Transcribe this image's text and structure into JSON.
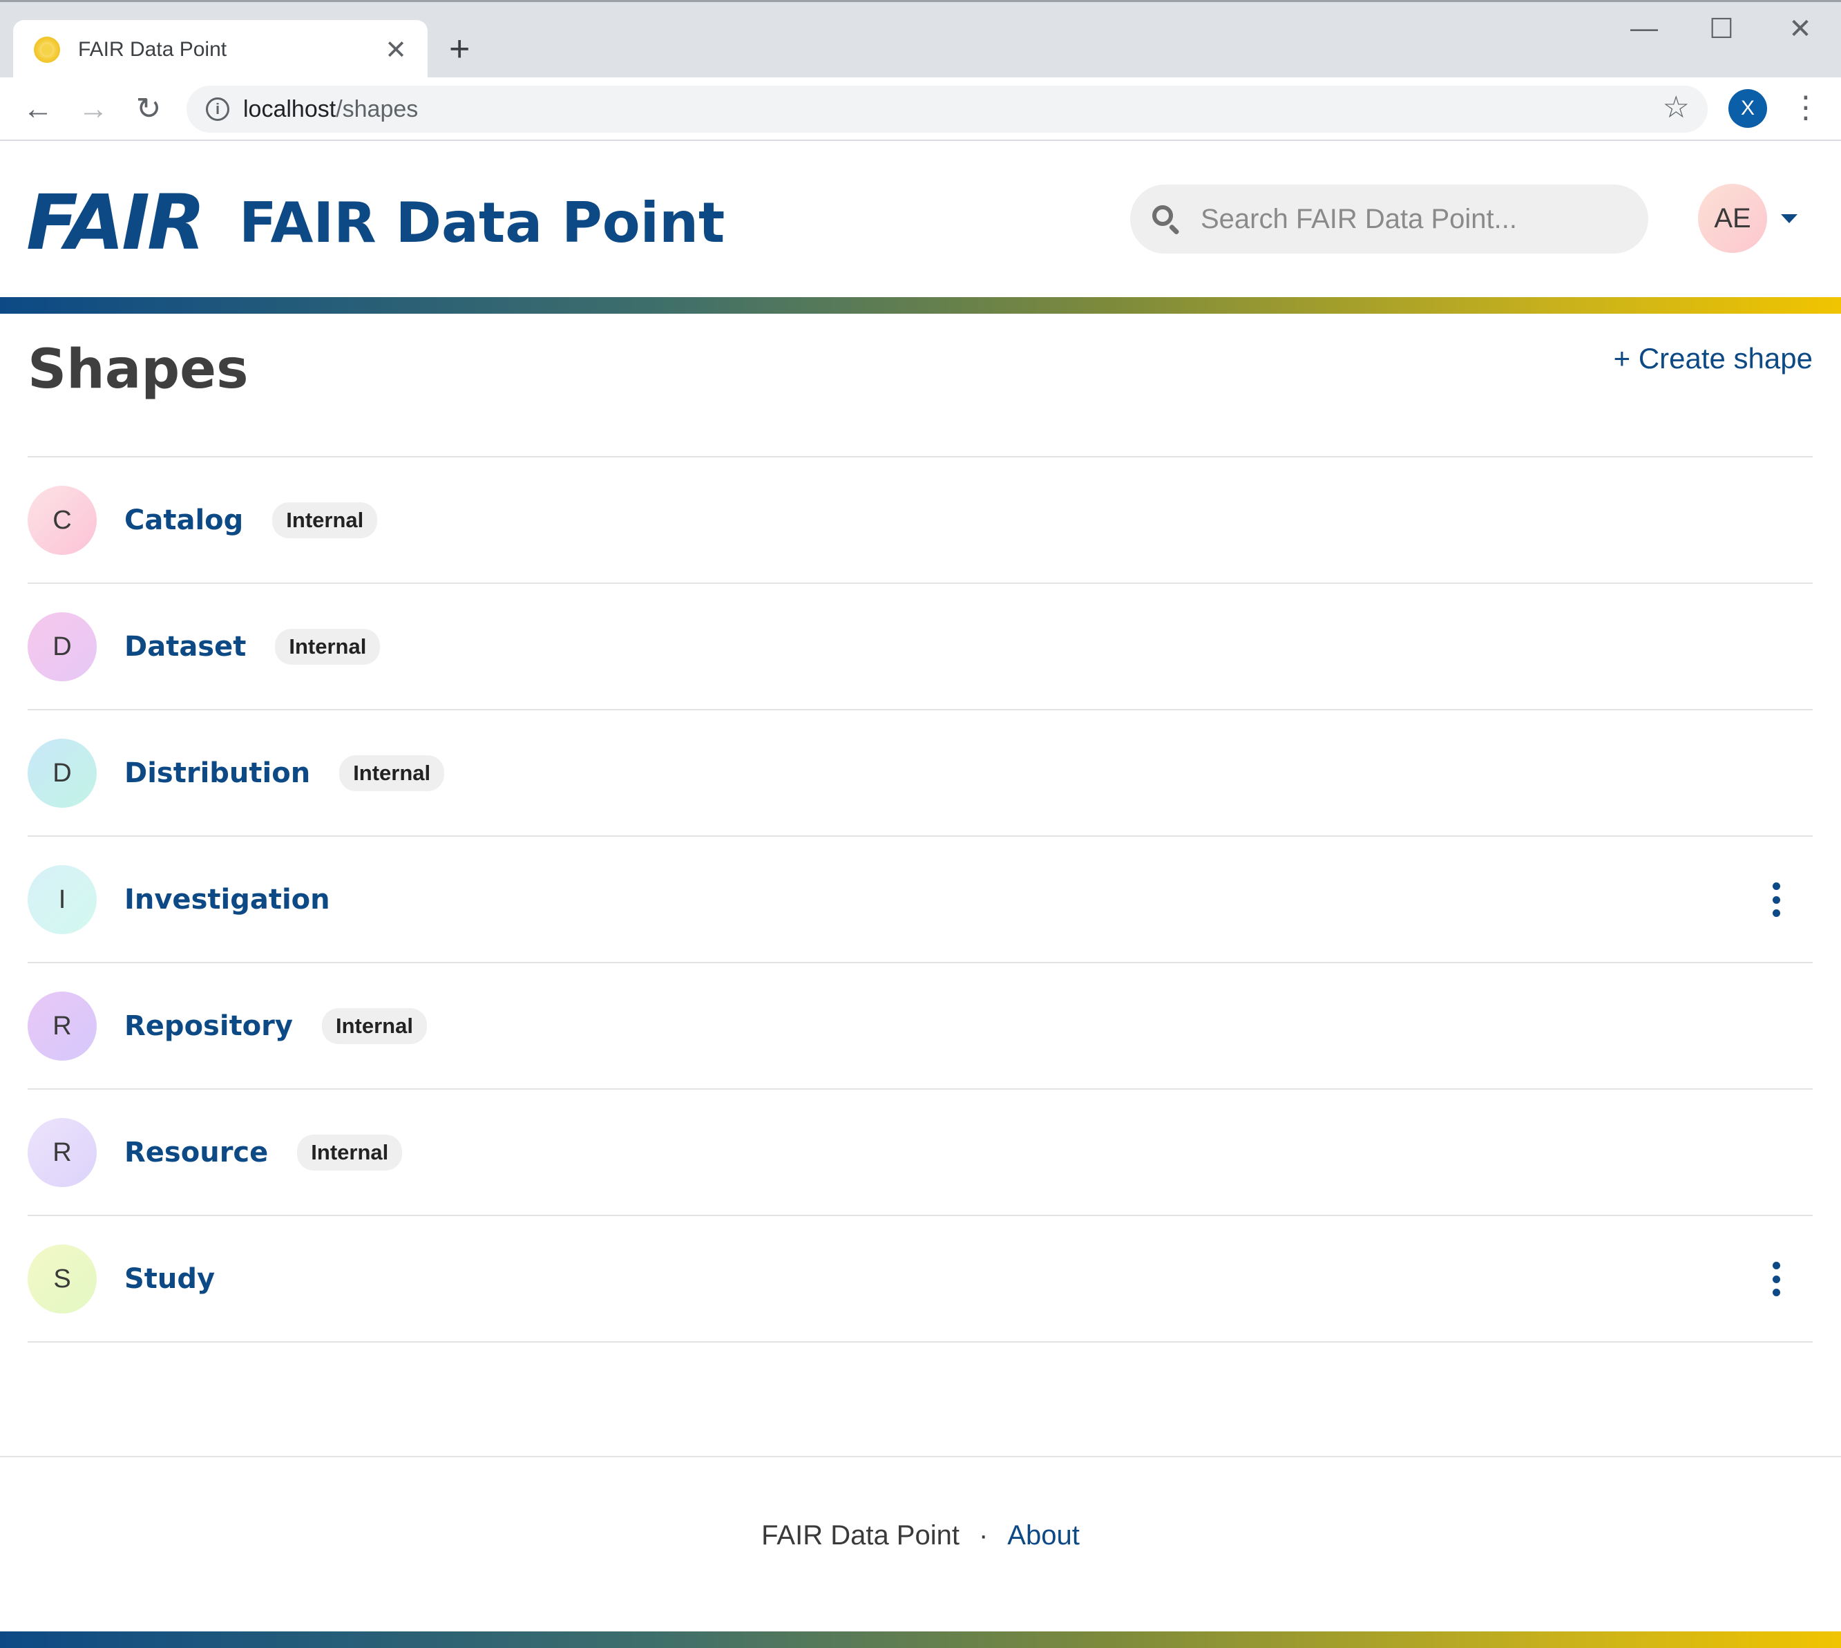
{
  "browser": {
    "tab_title": "FAIR Data Point",
    "tab_close": "✕",
    "new_tab": "+",
    "url_host": "localhost",
    "url_path": "/shapes",
    "profile_initial": "X",
    "window_controls": {
      "minimize": "—",
      "maximize": "☐",
      "close": "✕"
    },
    "nav": {
      "back": "←",
      "forward": "→",
      "reload": "↻"
    },
    "icons": {
      "favicon": "globe-icon",
      "info": "info-icon",
      "star": "star-icon",
      "menu": "kebab-icon"
    }
  },
  "header": {
    "logo_text": "FAIR",
    "app_title": "FAIR Data Point",
    "search_placeholder": "Search FAIR Data Point...",
    "user_initials": "AE"
  },
  "page": {
    "title": "Shapes",
    "create_label": "+ Create shape"
  },
  "shapes": [
    {
      "initial": "C",
      "name": "Catalog",
      "badge": "Internal",
      "color_from": "#fde2e6",
      "color_to": "#fbc3d6",
      "menu": false
    },
    {
      "initial": "D",
      "name": "Dataset",
      "badge": "Internal",
      "color_from": "#f6c8ec",
      "color_to": "#e6c8f6",
      "menu": false
    },
    {
      "initial": "D",
      "name": "Distribution",
      "badge": "Internal",
      "color_from": "#c8e8f8",
      "color_to": "#c3f3e6",
      "menu": false
    },
    {
      "initial": "I",
      "name": "Investigation",
      "badge": "",
      "color_from": "#d8f1f8",
      "color_to": "#d3f8ef",
      "menu": true
    },
    {
      "initial": "R",
      "name": "Repository",
      "badge": "Internal",
      "color_from": "#e8c8f6",
      "color_to": "#d6c8fb",
      "menu": false
    },
    {
      "initial": "R",
      "name": "Resource",
      "badge": "Internal",
      "color_from": "#ece3fb",
      "color_to": "#dcd3fb",
      "menu": false
    },
    {
      "initial": "S",
      "name": "Study",
      "badge": "",
      "color_from": "#f3f8c8",
      "color_to": "#e3f8c3",
      "menu": true
    }
  ],
  "footer": {
    "name": "FAIR Data Point",
    "separator": "·",
    "about": "About"
  },
  "colors": {
    "brand": "#0d4a85",
    "gradient_start": "#0d4a85",
    "gradient_end": "#f0c400"
  }
}
